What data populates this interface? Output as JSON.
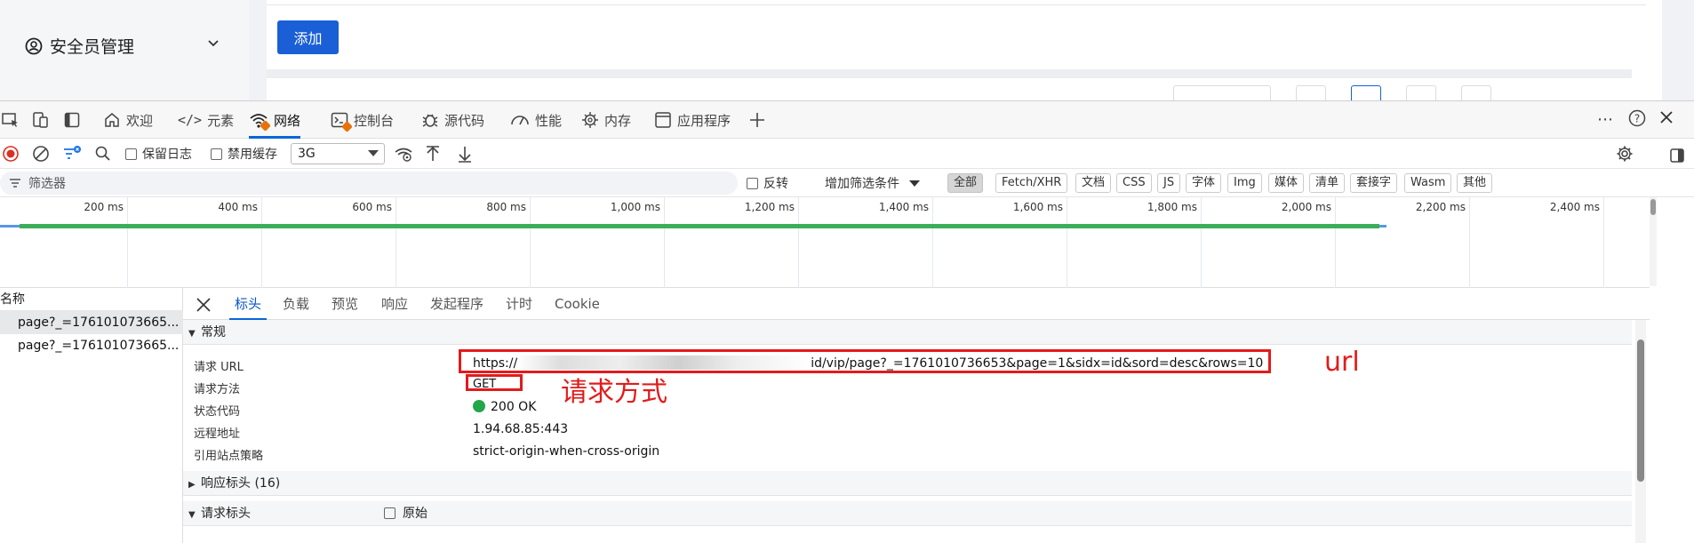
{
  "app": {
    "menu_label": "安全员管理",
    "add_button": "添加"
  },
  "devtools": {
    "tabs": [
      {
        "label": "欢迎"
      },
      {
        "label": "元素"
      },
      {
        "label": "网络"
      },
      {
        "label": "控制台"
      },
      {
        "label": "源代码"
      },
      {
        "label": "性能"
      },
      {
        "label": "内存"
      },
      {
        "label": "应用程序"
      }
    ],
    "toolbar": {
      "preserve_log": "保留日志",
      "disable_cache": "禁用缓存",
      "throttle": "3G"
    },
    "filter": {
      "placeholder": "筛选器",
      "invert": "反转",
      "more_filters": "增加筛选条件",
      "chips": [
        "全部",
        "Fetch/XHR",
        "文档",
        "CSS",
        "JS",
        "字体",
        "Img",
        "媒体",
        "清单",
        "套接字",
        "Wasm",
        "其他"
      ]
    },
    "timeline": {
      "ticks": [
        "200 ms",
        "400 ms",
        "600 ms",
        "800 ms",
        "1,000 ms",
        "1,200 ms",
        "1,400 ms",
        "1,600 ms",
        "1,800 ms",
        "2,000 ms",
        "2,200 ms",
        "2,400 ms"
      ]
    },
    "requests": {
      "header": "名称",
      "rows": [
        "page?_=176101073665...",
        "page?_=176101073665..."
      ]
    },
    "details": {
      "tabs": [
        "标头",
        "负载",
        "预览",
        "响应",
        "发起程序",
        "计时",
        "Cookie"
      ],
      "general_title": "常规",
      "general": {
        "url_key": "请求 URL",
        "url_prefix": "https://",
        "url_suffix": "id/vip/page?_=1761010736653&page=1&sidx=id&sord=desc&rows=10",
        "method_key": "请求方法",
        "method_val": "GET",
        "status_key": "状态代码",
        "status_val": "200 OK",
        "remote_key": "远程地址",
        "remote_val": "1.94.68.85:443",
        "referrer_key": "引用站点策略",
        "referrer_val": "strict-origin-when-cross-origin"
      },
      "response_headers": "响应标头 (16)",
      "request_headers": "请求标头",
      "raw_label": "原始"
    }
  },
  "annotations": {
    "url": "url",
    "method": "请求方式"
  },
  "colors": {
    "accent": "#0a66d8",
    "annotation": "#e21b1b",
    "success": "#22a64a",
    "timeline_bar": "#3cae5a"
  }
}
